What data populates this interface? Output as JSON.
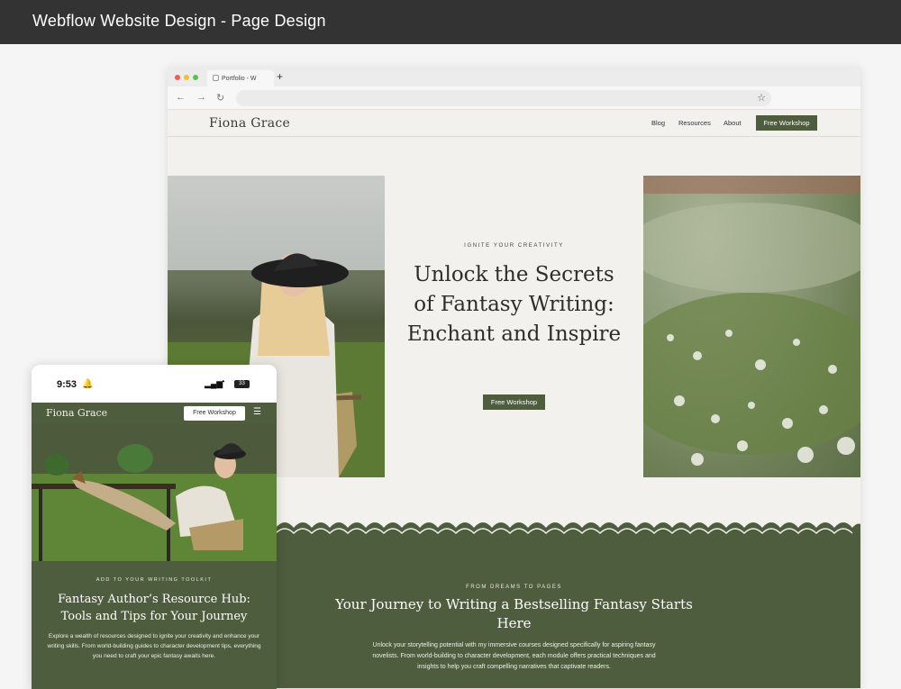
{
  "header": {
    "title": "Webflow Website Design - Page Design"
  },
  "browser": {
    "tab_label": "Portfolio - W",
    "new_tab": "+",
    "back": "←",
    "forward": "→",
    "reload": "↻",
    "bookmark": "☆"
  },
  "site": {
    "logo": "Fiona Grace",
    "nav": [
      "Blog",
      "Resources",
      "About"
    ],
    "nav_cta": "Free Workshop",
    "hero": {
      "kicker": "IGNITE YOUR CREATIVITY",
      "title": "Unlock the Secrets of Fantasy Writing: Enchant and Inspire",
      "cta": "Free Workshop"
    },
    "section": {
      "kicker": "FROM DREAMS TO PAGES",
      "title": "Your Journey to Writing a Bestselling Fantasy Starts Here",
      "body": "Unlock your storytelling potential with my immersive courses designed specifically for aspiring fantasy novelists. From world-building to character development, each module offers practical techniques and insights to help you craft compelling narratives that captivate readers."
    }
  },
  "mobile": {
    "time": "9:53",
    "battery": "33",
    "logo": "Fiona Grace",
    "cta": "Free Workshop",
    "kicker": "ADD TO YOUR WRITING TOOLKIT",
    "title": "Fantasy Author’s Resource Hub: Tools and Tips for Your Journey",
    "body": "Explore a wealth of resources designed to ignite your creativity and enhance your writing skills. From world-building guides to character development tips, everything you need to craft your epic fantasy awaits here."
  },
  "colors": {
    "brand_green": "#4d5d3d",
    "page_bg": "#f2f1ee",
    "topbar": "#333333"
  }
}
